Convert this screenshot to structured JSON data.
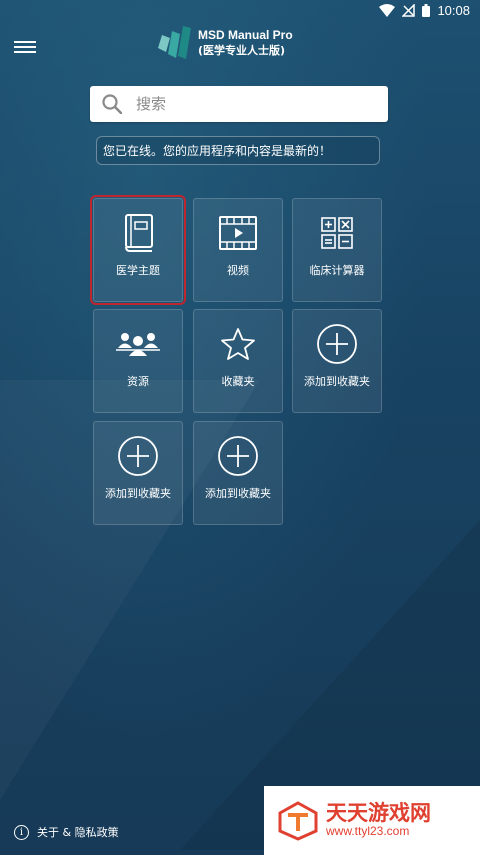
{
  "statusbar": {
    "time": "10:08"
  },
  "header": {
    "app_name": "MSD Manual Pro",
    "app_edition": "(医学专业人士版)"
  },
  "search": {
    "placeholder": "搜索"
  },
  "banner": {
    "message": "您已在线。您的应用程序和内容是最新的！"
  },
  "tiles": [
    {
      "label": "医学主题",
      "icon": "book-icon",
      "selected": true
    },
    {
      "label": "视频",
      "icon": "film-icon"
    },
    {
      "label": "临床计算器",
      "icon": "calculator-icon"
    },
    {
      "label": "资源",
      "icon": "people-icon"
    },
    {
      "label": "收藏夹",
      "icon": "star-icon"
    },
    {
      "label": "添加到收藏夹",
      "icon": "plus-circle-icon"
    },
    {
      "label": "添加到收藏夹",
      "icon": "plus-circle-icon"
    },
    {
      "label": "添加到收藏夹",
      "icon": "plus-circle-icon"
    }
  ],
  "footer": {
    "about_label": "关于 & 隐私政策"
  },
  "watermark": {
    "title": "天天游戏网",
    "url": "www.ttyl23.com"
  },
  "colors": {
    "selected_outline": "#c0262d",
    "watermark_accent": "#e04030"
  }
}
